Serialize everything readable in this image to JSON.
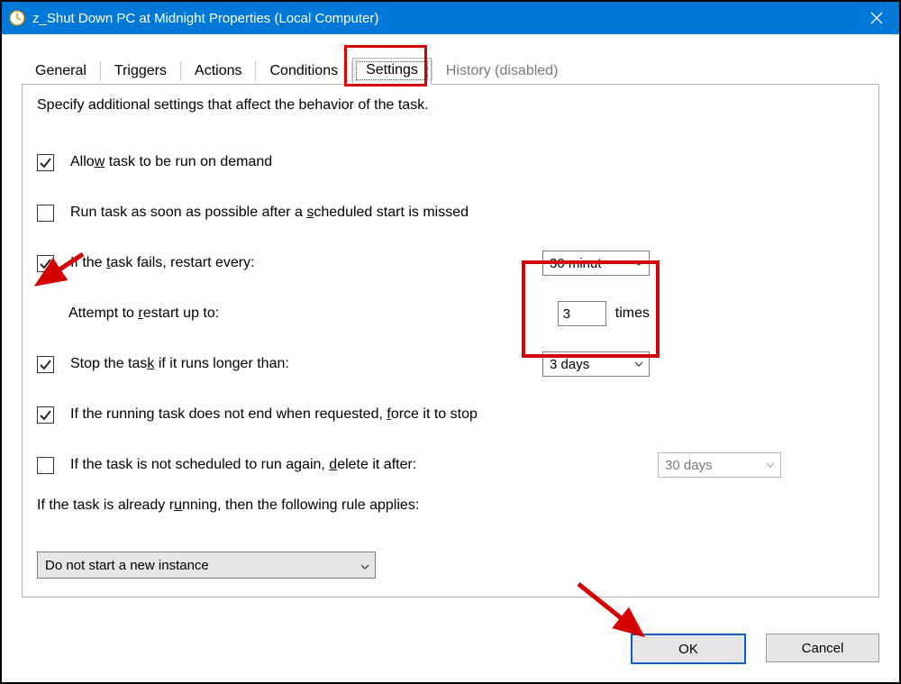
{
  "window": {
    "title": "z_Shut Down PC at Midnight Properties (Local Computer)"
  },
  "tabs": {
    "general": "General",
    "triggers": "Triggers",
    "actions": "Actions",
    "conditions": "Conditions",
    "settings": "Settings",
    "history": "History (disabled)"
  },
  "settings": {
    "intro": "Specify additional settings that affect the behavior of the task.",
    "allow_on_demand": {
      "checked": true,
      "label_pre": "Allo",
      "label_u": "w",
      "label_post": " task to be run on demand"
    },
    "run_asap": {
      "checked": false,
      "label_pre": "Run task as soon as possible after a ",
      "label_u": "s",
      "label_post": "cheduled start is missed"
    },
    "restart_every": {
      "checked": true,
      "label_pre": "If the ",
      "label_u": "t",
      "label_post": "ask fails, restart every:",
      "value": "30 minut"
    },
    "attempt_upto": {
      "label_pre": "Attempt to ",
      "label_u": "r",
      "label_post": "estart up to:",
      "value": "3",
      "times": "times"
    },
    "stop_longer": {
      "checked": true,
      "label_pre": "Stop the tas",
      "label_u": "k",
      "label_post": " if it runs longer than:",
      "value": "3 days"
    },
    "force_stop": {
      "checked": true,
      "label_pre": "If the running task does not end when requested, ",
      "label_u": "f",
      "label_post": "orce it to stop"
    },
    "delete_after": {
      "checked": false,
      "label_pre": "If the task is not scheduled to run again, ",
      "label_u": "d",
      "label_post": "elete it after:",
      "value": "30 days"
    },
    "rule_intro": {
      "label_pre": "If the task is already r",
      "label_u": "u",
      "label_post": "nning, then the following rule applies:"
    },
    "rule_value": "Do not start a new instance"
  },
  "buttons": {
    "ok": "OK",
    "cancel": "Cancel"
  }
}
